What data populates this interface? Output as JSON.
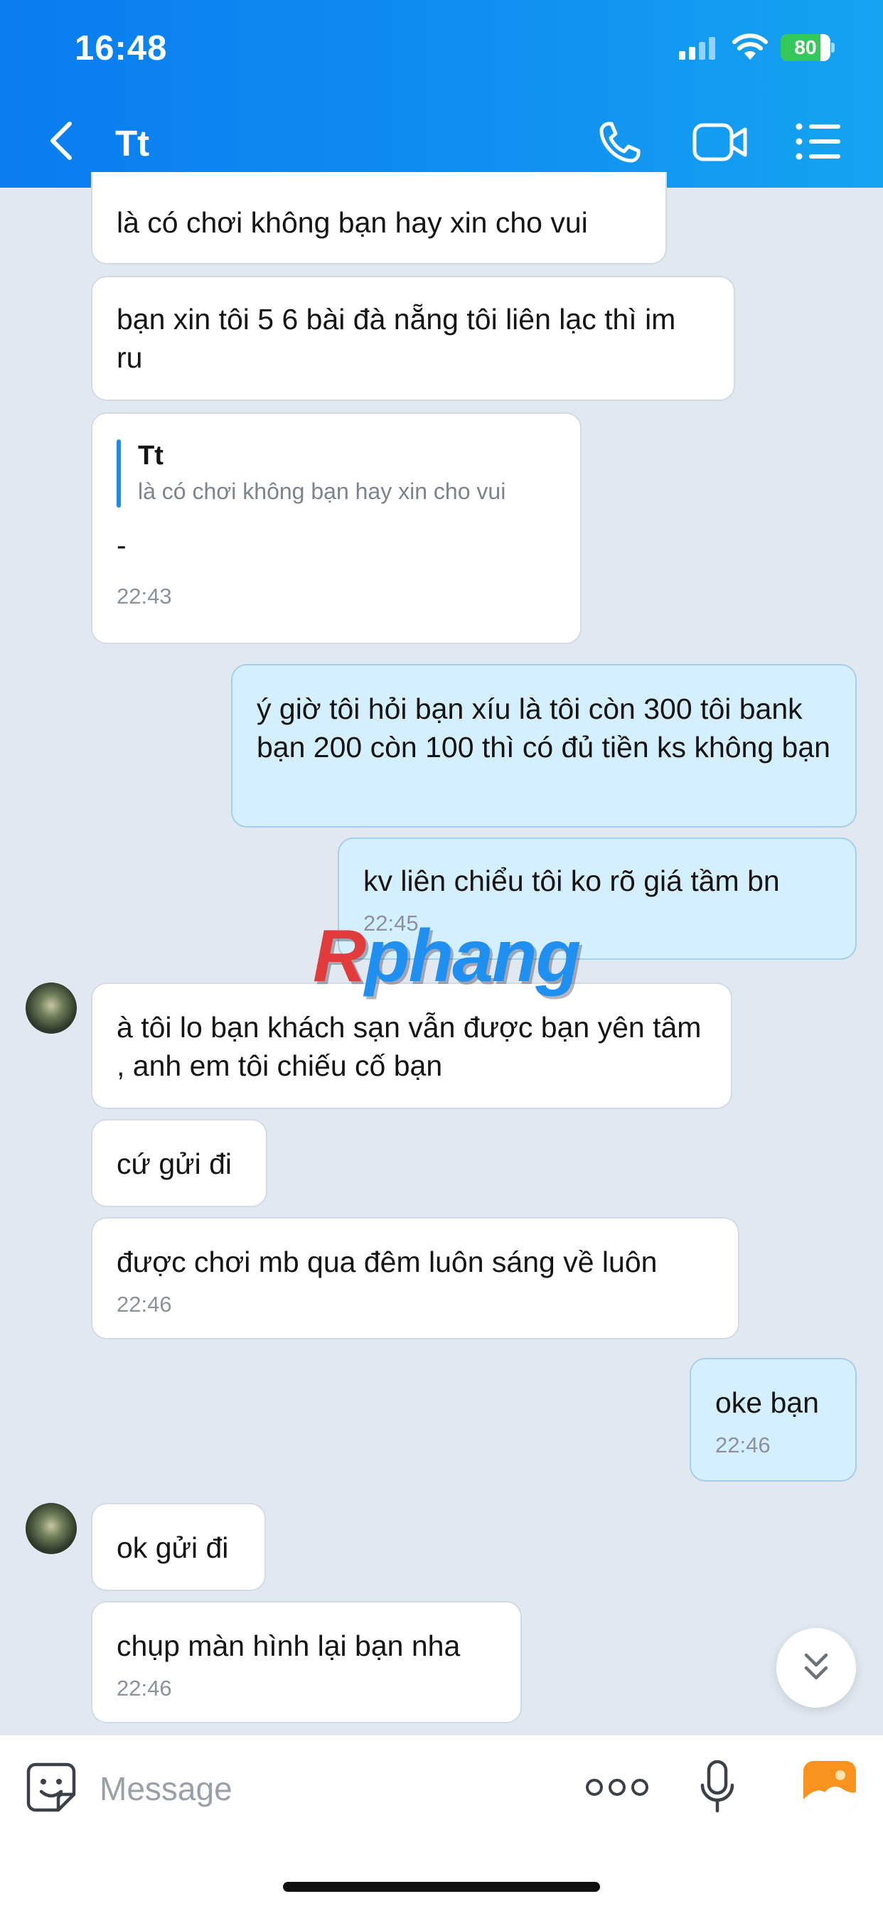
{
  "status_bar": {
    "time": "16:48",
    "battery": "80",
    "battery_level_percent": 80
  },
  "header": {
    "title": "Tt"
  },
  "messages": [
    {
      "text": "là có chơi không bạn hay xin cho vui"
    },
    {
      "text": "bạn xin tôi 5 6 bài đà nẵng tôi liên lạc thì im ru"
    },
    {
      "quote_name": "Tt",
      "quote_text": "là có chơi không bạn hay xin cho vui",
      "text": "-",
      "time": "22:43"
    },
    {
      "text": "ý giờ tôi hỏi bạn xíu là tôi còn 300 tôi bank bạn 200 còn 100 thì có đủ tiền ks không bạn"
    },
    {
      "text": "kv liên chiểu tôi ko rõ giá tầm bn",
      "time": "22:45"
    },
    {
      "text": "à tôi lo bạn khách sạn vẫn được bạn yên tâm , anh em tôi chiếu cố bạn"
    },
    {
      "text": "cứ gửi đi"
    },
    {
      "text": "được chơi mb qua đêm luôn sáng về luôn",
      "time": "22:46"
    },
    {
      "text": "oke bạn",
      "time": "22:46"
    },
    {
      "text": "ok gửi đi"
    },
    {
      "text": "chụp màn hình lại bạn nha",
      "time": "22:46"
    }
  ],
  "watermark": {
    "part1": "R",
    "part2": "phang"
  },
  "input": {
    "placeholder": "Message"
  },
  "colors": {
    "header_start": "#0a7cf0",
    "header_end": "#16a3f0",
    "sent_bubble": "#d4efff",
    "received_bubble": "#ffffff",
    "background": "#e2e8f0",
    "accent": "#1d8af3",
    "image_button": "#f7931e"
  },
  "icons": [
    "chevron-left-icon",
    "phone-icon",
    "video-camera-icon",
    "list-menu-icon",
    "sticker-icon",
    "more-icon",
    "microphone-icon",
    "image-icon",
    "double-chevron-down-icon"
  ]
}
